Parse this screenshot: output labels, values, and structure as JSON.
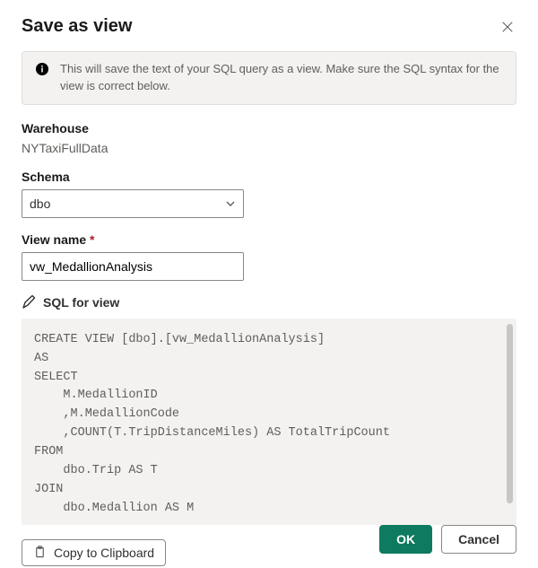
{
  "dialogTitle": "Save as view",
  "infoText": "This will save the text of your SQL query as a view. Make sure the SQL syntax for the view is correct below.",
  "warehouse": {
    "label": "Warehouse",
    "value": "NYTaxiFullData"
  },
  "schema": {
    "label": "Schema",
    "value": "dbo"
  },
  "viewName": {
    "label": "View name",
    "required": "*",
    "value": "vw_MedallionAnalysis"
  },
  "sqlSection": {
    "label": "SQL for view"
  },
  "sqlCode": "CREATE VIEW [dbo].[vw_MedallionAnalysis]\nAS\nSELECT\n    M.MedallionID\n    ,M.MedallionCode\n    ,COUNT(T.TripDistanceMiles) AS TotalTripCount\nFROM\n    dbo.Trip AS T\nJOIN\n    dbo.Medallion AS M",
  "buttons": {
    "copy": "Copy to Clipboard",
    "ok": "OK",
    "cancel": "Cancel"
  }
}
